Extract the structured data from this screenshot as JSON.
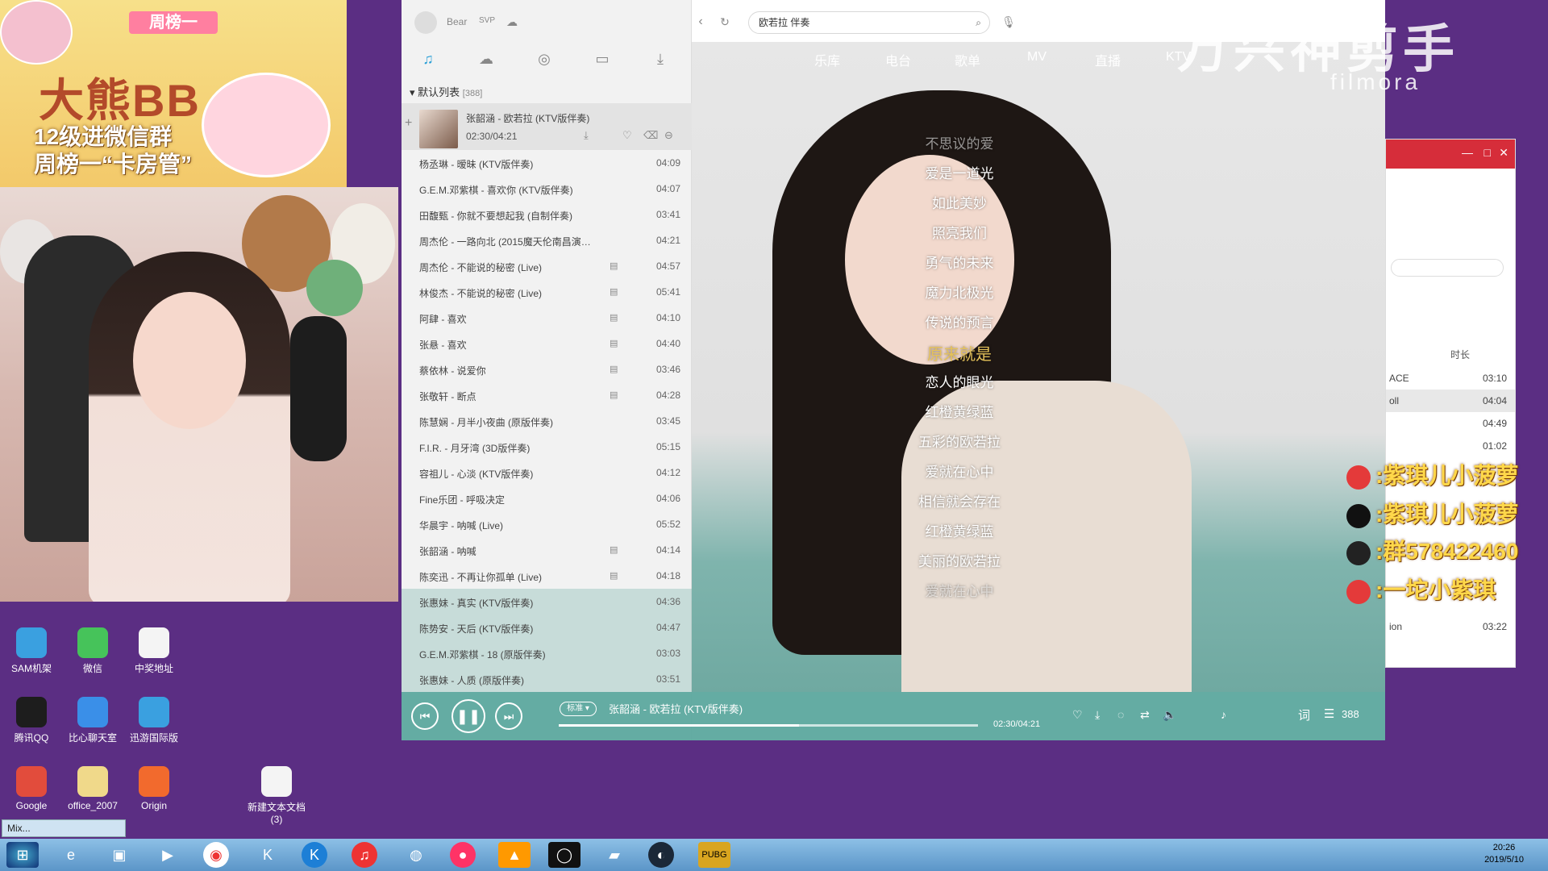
{
  "banner": {
    "tag": "周榜一",
    "title": "大熊BB",
    "line1": "12级进微信群",
    "line2": "周榜一“卡房管”"
  },
  "desktop_icons": [
    {
      "label": "SAM机架",
      "color": "#3aa0e0"
    },
    {
      "label": "微信",
      "color": "#46c35a"
    },
    {
      "label": "中奖地址",
      "color": "#f4f4f4"
    },
    {
      "label": "腾讯QQ",
      "color": "#1d1d1d"
    },
    {
      "label": "比心聊天室",
      "color": "#3a8fe8"
    },
    {
      "label": "迅游国际版",
      "color": "#3aa0e0"
    },
    {
      "label": "Google",
      "color": "#e24c3c"
    },
    {
      "label": "office_2007",
      "color": "#f0d98a"
    },
    {
      "label": "Origin",
      "color": "#f26a2d"
    },
    {
      "label": "新建文本文档\n(3)",
      "color": "#f4f4f4"
    }
  ],
  "player": {
    "user": "Bear",
    "vip": "SVP",
    "search_value": "欧若拉 伴奏",
    "nav_tabs": [
      "乐库",
      "电台",
      "歌单",
      "MV",
      "直播",
      "KTV"
    ],
    "list_header": "默认列表",
    "list_count": "[388]",
    "current": {
      "title": "张韶涵 - 欧若拉 (KTV版伴奏)",
      "time": "02:30/04:21"
    },
    "songs": [
      {
        "title": "杨丞琳 - 暧昧 (KTV版伴奏)",
        "dur": "04:09",
        "mv": false
      },
      {
        "title": "G.E.M.邓紫棋 - 喜欢你 (KTV版伴奏)",
        "dur": "04:07",
        "mv": false
      },
      {
        "title": "田馥甄 - 你就不要想起我 (自制伴奏)",
        "dur": "03:41",
        "mv": false
      },
      {
        "title": "周杰伦 - 一路向北 (2015魔天伦南昌演…",
        "dur": "04:21",
        "mv": false
      },
      {
        "title": "周杰伦 - 不能说的秘密 (Live)",
        "dur": "04:57",
        "mv": true
      },
      {
        "title": "林俊杰 - 不能说的秘密 (Live)",
        "dur": "05:41",
        "mv": true
      },
      {
        "title": "阿肆 - 喜欢",
        "dur": "04:10",
        "mv": true
      },
      {
        "title": "张悬 - 喜欢",
        "dur": "04:40",
        "mv": true
      },
      {
        "title": "蔡依林 - 说爱你",
        "dur": "03:46",
        "mv": true
      },
      {
        "title": "张敬轩 - 断点",
        "dur": "04:28",
        "mv": true
      },
      {
        "title": "陈慧娴 - 月半小夜曲 (原版伴奏)",
        "dur": "03:45",
        "mv": false
      },
      {
        "title": "F.I.R. - 月牙湾 (3D版伴奏)",
        "dur": "05:15",
        "mv": false
      },
      {
        "title": "容祖儿 - 心淡 (KTV版伴奏)",
        "dur": "04:12",
        "mv": false
      },
      {
        "title": "Fine乐团 - 呼吸决定",
        "dur": "04:06",
        "mv": false
      },
      {
        "title": "华晨宇 - 呐喊 (Live)",
        "dur": "05:52",
        "mv": false
      },
      {
        "title": "张韶涵 - 呐喊",
        "dur": "04:14",
        "mv": true
      },
      {
        "title": "陈奕迅 - 不再让你孤单 (Live)",
        "dur": "04:18",
        "mv": true
      },
      {
        "title": "张惠妹 - 真实 (KTV版伴奏)",
        "dur": "04:36",
        "mv": false
      },
      {
        "title": "陈势安 - 天后 (KTV版伴奏)",
        "dur": "04:47",
        "mv": false
      },
      {
        "title": "G.E.M.邓紫棋 - 18 (原版伴奏)",
        "dur": "03:03",
        "mv": false
      },
      {
        "title": "张惠妹 - 人质 (原版伴奏)",
        "dur": "03:51",
        "mv": false
      }
    ],
    "lyrics": [
      {
        "text": "不思议的爱",
        "style": "dim"
      },
      {
        "text": "爱是一道光",
        "style": ""
      },
      {
        "text": "如此美妙",
        "style": ""
      },
      {
        "text": "照亮我们",
        "style": ""
      },
      {
        "text": "勇气的未来",
        "style": ""
      },
      {
        "text": "魔力北极光",
        "style": ""
      },
      {
        "text": "传说的预言",
        "style": ""
      },
      {
        "text": "原来就是",
        "style": "hi"
      },
      {
        "text": "恋人的眼光",
        "style": ""
      },
      {
        "text": "红橙黄绿蓝",
        "style": ""
      },
      {
        "text": "五彩的欧若拉",
        "style": ""
      },
      {
        "text": "爱就在心中",
        "style": ""
      },
      {
        "text": "相信就会存在",
        "style": ""
      },
      {
        "text": "红橙黄绿蓝",
        "style": ""
      },
      {
        "text": "美丽的欧若拉",
        "style": ""
      },
      {
        "text": "爱就在心中",
        "style": "dim"
      }
    ],
    "now_playing": "张韶涵 - 欧若拉 (KTV版伴奏)",
    "now_time": "02:30/04:21",
    "progress_fraction": 0.574,
    "bottom_right": {
      "lyric_btn": "词",
      "count": "388"
    }
  },
  "watermark": {
    "cn": "万兴神剪手",
    "en": "filmora"
  },
  "sidewin": {
    "col_header": "时长",
    "rows": [
      {
        "t": "ACE",
        "d": "03:10"
      },
      {
        "t": "oll",
        "d": "04:04"
      },
      {
        "t": "",
        "d": "04:49"
      },
      {
        "t": "",
        "d": "01:02"
      },
      {
        "t": "ion",
        "d": "03:22"
      }
    ]
  },
  "social": [
    {
      "text": ":紫琪儿小菠萝",
      "color": "#e43a3a"
    },
    {
      "text": ":紫琪儿小菠萝",
      "color": "#111"
    },
    {
      "text": ":群578422460",
      "color": "#222"
    },
    {
      "text": ":一坨小紫琪",
      "color": "#e43a3a"
    }
  ],
  "taskbar": {
    "mix_label": "Mix...",
    "clock_time": "20:26",
    "clock_date": "2019/5/10"
  }
}
